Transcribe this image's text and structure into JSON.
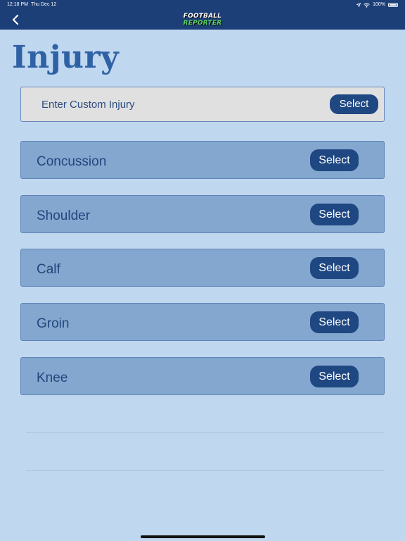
{
  "status_bar": {
    "time": "12:18 PM",
    "date": "Thu Dec 12",
    "battery": "100%"
  },
  "nav": {
    "logo_line1": "FOOTBALL",
    "logo_line2": "REPORTER"
  },
  "page": {
    "title": "Injury"
  },
  "custom": {
    "label": "Enter Custom Injury",
    "button": "Select"
  },
  "injuries": [
    {
      "label": "Concussion",
      "button": "Select"
    },
    {
      "label": "Shoulder",
      "button": "Select"
    },
    {
      "label": "Calf",
      "button": "Select"
    },
    {
      "label": "Groin",
      "button": "Select"
    },
    {
      "label": "Knee",
      "button": "Select"
    }
  ],
  "colors": {
    "nav_bg": "#1d3f78",
    "page_bg": "#c0d7f0",
    "title": "#2f62a5",
    "row_bg": "#84a7cf",
    "button_bg": "#1f4782",
    "logo_accent": "#5bd45b"
  },
  "icons": {
    "back": "chevron-left-icon",
    "wifi": "wifi-icon",
    "battery": "battery-icon"
  }
}
